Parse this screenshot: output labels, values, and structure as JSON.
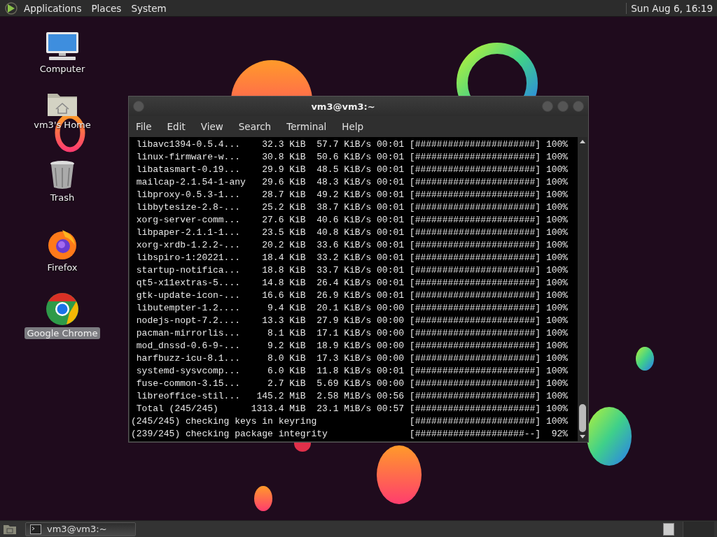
{
  "top_panel": {
    "menus": [
      "Applications",
      "Places",
      "System"
    ],
    "clock": "Sun Aug  6, 16:19"
  },
  "desktop_icons": [
    {
      "label": "Computer",
      "kind": "computer",
      "selected": false
    },
    {
      "label": "vm3's Home",
      "kind": "home",
      "selected": false
    },
    {
      "label": "Trash",
      "kind": "trash",
      "selected": false
    },
    {
      "label": "Firefox",
      "kind": "firefox",
      "selected": false
    },
    {
      "label": "Google Chrome",
      "kind": "chrome",
      "selected": true
    }
  ],
  "terminal": {
    "title": "vm3@vm3:~",
    "menus": [
      "File",
      "Edit",
      "View",
      "Search",
      "Terminal",
      "Help"
    ],
    "lines": [
      " libavc1394-0.5.4...    32.3 KiB  57.7 KiB/s 00:01 [######################] 100%",
      " linux-firmware-w...    30.8 KiB  50.6 KiB/s 00:01 [######################] 100%",
      " libatasmart-0.19...    29.9 KiB  48.5 KiB/s 00:01 [######################] 100%",
      " mailcap-2.1.54-1-any   29.6 KiB  48.3 KiB/s 00:01 [######################] 100%",
      " libproxy-0.5.3-1...    28.7 KiB  49.2 KiB/s 00:01 [######################] 100%",
      " libbytesize-2.8-...    25.2 KiB  38.7 KiB/s 00:01 [######################] 100%",
      " xorg-server-comm...    27.6 KiB  40.6 KiB/s 00:01 [######################] 100%",
      " libpaper-2.1.1-1...    23.5 KiB  40.8 KiB/s 00:01 [######################] 100%",
      " xorg-xrdb-1.2.2-...    20.2 KiB  33.6 KiB/s 00:01 [######################] 100%",
      " libspiro-1:20221...    18.4 KiB  33.2 KiB/s 00:01 [######################] 100%",
      " startup-notifica...    18.8 KiB  33.7 KiB/s 00:01 [######################] 100%",
      " qt5-x11extras-5....    14.8 KiB  26.4 KiB/s 00:01 [######################] 100%",
      " gtk-update-icon-...    16.6 KiB  26.9 KiB/s 00:01 [######################] 100%",
      " libutempter-1.2....     9.4 KiB  20.1 KiB/s 00:00 [######################] 100%",
      " nodejs-nopt-7.2....    13.3 KiB  27.9 KiB/s 00:00 [######################] 100%",
      " pacman-mirrorlis...     8.1 KiB  17.1 KiB/s 00:00 [######################] 100%",
      " mod_dnssd-0.6-9-...     9.2 KiB  18.9 KiB/s 00:00 [######################] 100%",
      " harfbuzz-icu-8.1...     8.0 KiB  17.3 KiB/s 00:00 [######################] 100%",
      " systemd-sysvcomp...     6.0 KiB  11.8 KiB/s 00:01 [######################] 100%",
      " fuse-common-3.15...     2.7 KiB  5.69 KiB/s 00:00 [######################] 100%",
      " libreoffice-stil...   145.2 MiB  2.58 MiB/s 00:56 [######################] 100%",
      " Total (245/245)      1313.4 MiB  23.1 MiB/s 00:57 [######################] 100%",
      "(245/245) checking keys in keyring                 [######################] 100%",
      "(239/245) checking package integrity               [####################--]  92%"
    ]
  },
  "taskbar": {
    "tasks": [
      {
        "label": "vm3@vm3:~",
        "selected": true
      }
    ]
  }
}
